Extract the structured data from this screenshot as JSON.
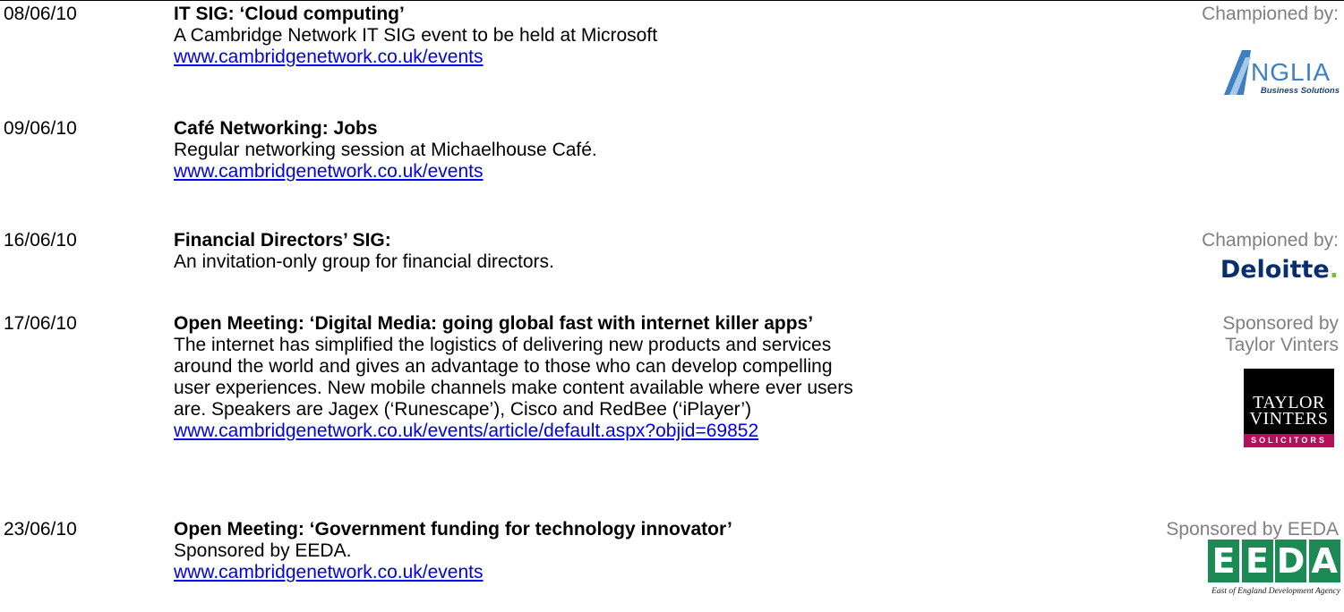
{
  "events": [
    {
      "date": "08/06/10",
      "title": "IT SIG: ‘Cloud computing’",
      "description": "A Cambridge Network IT SIG event to be held at Microsoft",
      "link": "www.cambridgenetwork.co.uk/events",
      "sponsor": {
        "text": "Championed by:",
        "logo_name": "Anglia Business Solutions",
        "logo_text": "NGLIA",
        "logo_sub": "Business Solutions"
      }
    },
    {
      "date": "09/06/10",
      "title": "Café Networking: Jobs",
      "description": "Regular networking session at Michaelhouse Café.",
      "link": "www.cambridgenetwork.co.uk/events"
    },
    {
      "date": "16/06/10",
      "title": "Financial Directors’ SIG:",
      "description": "An invitation-only group for financial directors.",
      "sponsor": {
        "text": "Championed by:",
        "logo_text": "Deloitte",
        "logo_dot": "."
      }
    },
    {
      "date": "17/06/10",
      "title": "Open Meeting: ‘Digital Media: going global fast with internet killer apps’",
      "description": "The internet has simplified the logistics of delivering new products and services around the world and gives an advantage to those who can develop compelling user experiences. New mobile channels make content available where ever users are. Speakers are Jagex (‘Runescape’), Cisco and RedBee (‘iPlayer’)",
      "link": "www.cambridgenetwork.co.uk/events/article/default.aspx?objid=69852",
      "sponsor": {
        "text_line1": "Sponsored by",
        "text_line2": "Taylor Vinters",
        "logo_line1": "TAYLOR",
        "logo_line2": "VINTERS",
        "logo_band": "SOLICITORS"
      }
    },
    {
      "date": "23/06/10",
      "title": "Open Meeting: ‘Government funding for technology  innovator’",
      "description": "Sponsored by EEDA.",
      "link": "www.cambridgenetwork.co.uk/events",
      "sponsor": {
        "text": "Sponsored by EEDA",
        "logo_letters": [
          "E",
          "E",
          "D",
          "A"
        ],
        "logo_sub": "East of England Development Agency"
      }
    }
  ],
  "colors": {
    "link": "#0000ee",
    "sponsor_text": "#808080",
    "deloitte_blue": "#0a2d6e",
    "deloitte_green": "#86bc25",
    "eeda_green": "#1c8a55",
    "taylor_vinters_band": "#b2125a",
    "anglia_blue": "#3d7fc1"
  }
}
